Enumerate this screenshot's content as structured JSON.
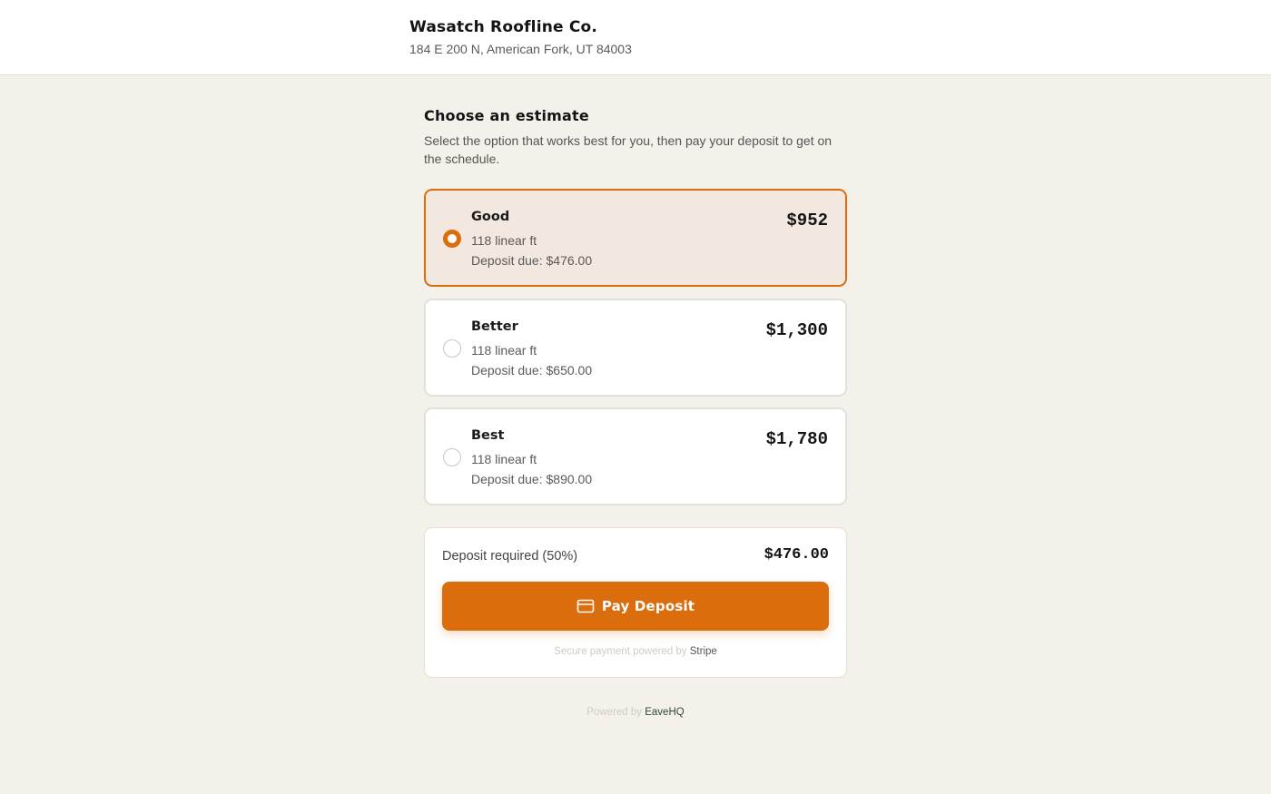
{
  "header": {
    "company_name": "Wasatch Roofline Co.",
    "address": "184 E 200 N, American Fork, UT 84003"
  },
  "main": {
    "title": "Choose an estimate",
    "subtitle": "Select the option that works best for you, then pay your deposit to get on the schedule.",
    "options": [
      {
        "name": "Good",
        "length": "118 linear ft",
        "deposit": "Deposit due: $476.00",
        "price": "$952",
        "selected": true
      },
      {
        "name": "Better",
        "length": "118 linear ft",
        "deposit": "Deposit due: $650.00",
        "price": "$1,300",
        "selected": false
      },
      {
        "name": "Best",
        "length": "118 linear ft",
        "deposit": "Deposit due: $890.00",
        "price": "$1,780",
        "selected": false
      }
    ]
  },
  "payment": {
    "deposit_label": "Deposit required (50%)",
    "deposit_amount": "$476.00",
    "button_label": "Pay Deposit",
    "secure_prefix": "Secure payment powered by",
    "secure_brand": "Stripe"
  },
  "footer": {
    "prefix": "Powered by",
    "brand": "EaveHQ"
  },
  "colors": {
    "accent": "#db6d0d",
    "selected_bg": "#f3e8df",
    "page_bg": "#f4f1eb"
  },
  "icons": {
    "pay_button": "credit-card-icon",
    "radio_selected": "radio-selected-icon",
    "radio_unselected": "radio-unselected-icon"
  }
}
